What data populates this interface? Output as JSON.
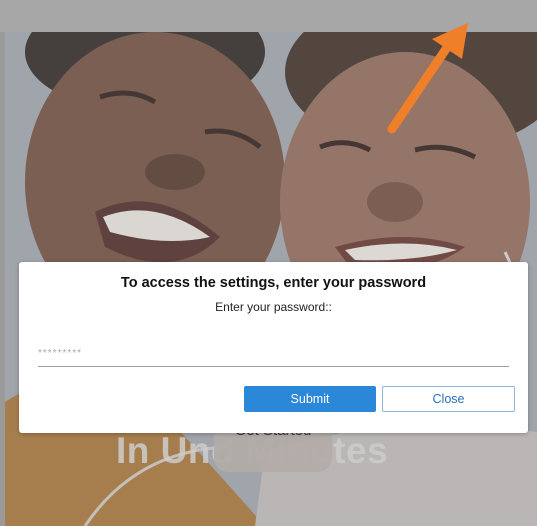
{
  "dialog": {
    "title": "To access the settings, enter your password",
    "subtitle": "Enter your password::",
    "password_value": "",
    "password_placeholder": "*********",
    "submit_label": "Submit",
    "close_label": "Close"
  },
  "background": {
    "cta_label": "Get Started",
    "headline_visible": "In Und          Minutes"
  },
  "colors": {
    "accent": "#2b88d9",
    "annotation_arrow": "#f07f2a",
    "overlay": "#a7a7a7"
  },
  "icons": {
    "annotation": "arrow-up-right-icon"
  }
}
